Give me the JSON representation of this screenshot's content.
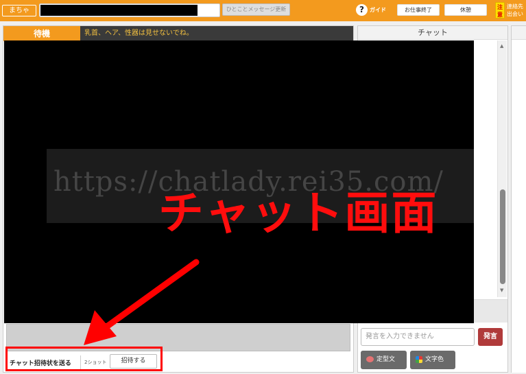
{
  "topbar": {
    "user_button": "まちゃ",
    "message_update_button": "ひとことメッセージ更新",
    "guide_label": "ガイド",
    "help_icon_glyph": "?",
    "end_work_button": "お仕事終了",
    "break_button": "休憩",
    "notice_badge": "注意",
    "notice_text_line1": "連絡先",
    "notice_text_line2": "出会い"
  },
  "main": {
    "status_tab": "待機",
    "status_notice": "乳首、ヘア、性器は見せないでね。",
    "watermark": "https://chatlady.rei35.com/",
    "overlay_label": "チャット画面"
  },
  "invite": {
    "label": "チャット招待状を送る",
    "shot_type": "2ショット",
    "button": "招待する"
  },
  "chat": {
    "header": "チャット",
    "input_placeholder": "発言を入力できません",
    "send_button": "発言",
    "preset_button": "定型文",
    "color_button": "文字色",
    "scroll_up_glyph": "▲",
    "scroll_down_glyph": "▼"
  },
  "colors": {
    "brand_orange": "#f39a1e",
    "annotation_red": "#ff0000",
    "send_red": "#b03a3a"
  }
}
